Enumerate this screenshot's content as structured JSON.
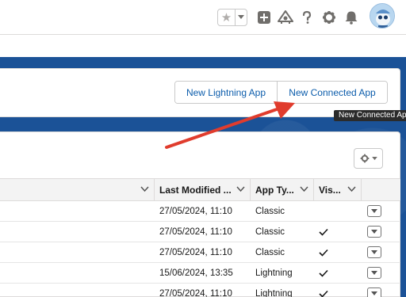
{
  "header": {
    "icons": [
      "star-icon",
      "chevron-down-icon",
      "add-icon",
      "trailhead-icon",
      "help-icon",
      "settings-icon",
      "notifications-icon",
      "avatar"
    ]
  },
  "buttons": {
    "new_lightning_app": "New Lightning App",
    "new_connected_app": "New Connected App"
  },
  "tooltip": "New Connected App",
  "table": {
    "columns": [
      "Last Modified ...",
      "App Ty...",
      "Vis..."
    ],
    "rows": [
      {
        "last_modified": "27/05/2024, 11:10",
        "app_type": "Classic",
        "visible": false
      },
      {
        "last_modified": "27/05/2024, 11:10",
        "app_type": "Classic",
        "visible": true
      },
      {
        "last_modified": "27/05/2024, 11:10",
        "app_type": "Classic",
        "visible": true
      },
      {
        "last_modified": "15/06/2024, 13:35",
        "app_type": "Lightning",
        "visible": true
      },
      {
        "last_modified": "27/05/2024, 11:10",
        "app_type": "Lightning",
        "visible": true
      }
    ]
  },
  "colors": {
    "brand_band": "#1b5297",
    "link_blue": "#0b5cab",
    "arrow_red": "#e03c2d"
  }
}
